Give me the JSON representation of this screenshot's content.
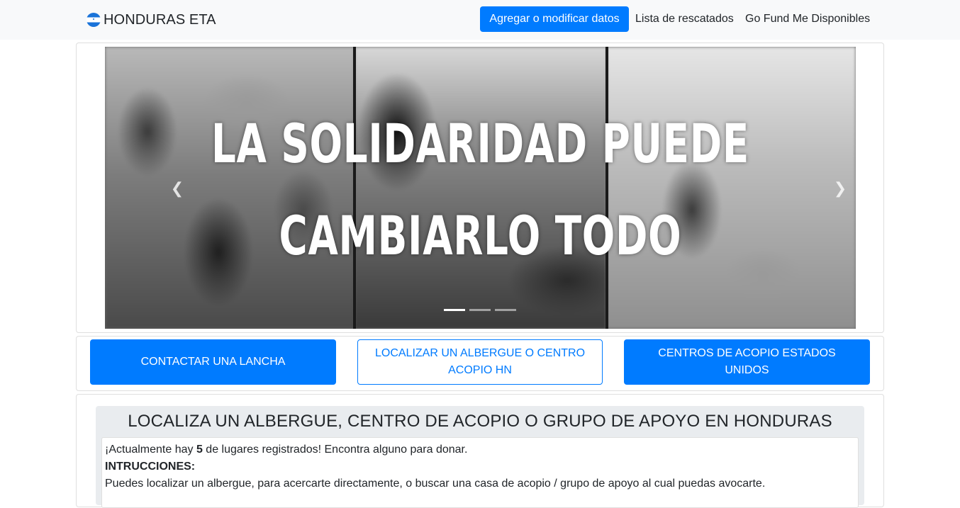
{
  "navbar": {
    "brand": "HONDURAS ETA",
    "primary_button": "Agregar o modificar datos",
    "links": [
      "Lista de rescatados",
      "Go Fund Me Disponibles"
    ]
  },
  "carousel": {
    "caption_line1": "LA SOLIDARIDAD PUEDE",
    "caption_line2": "CAMBIARLO TODO",
    "prev_label": "Previous",
    "next_label": "Next",
    "slide_count": 3,
    "active_slide": 1
  },
  "actions": {
    "contact_boat": "CONTACTAR UNA LANCHA",
    "locate_shelter": "LOCALIZAR UN ALBERGUE O CENTRO ACOPIO HN",
    "us_centers": "CENTROS DE ACOPIO ESTADOS UNIDOS"
  },
  "info": {
    "title": "LOCALIZA UN ALBERGUE, CENTRO DE ACOPIO O GRUPO DE APOYO EN HONDURAS",
    "count_prefix": "¡Actualmente hay ",
    "count": "5",
    "count_suffix": " de lugares registrados! Encontra alguno para donar.",
    "instructions_label": "INTRUCCIONES:",
    "instructions_text": "Puedes localizar un albergue, para acercarte directamente, o buscar una casa de acopio / grupo de apoyo al cual puedas avocarte."
  },
  "colors": {
    "primary": "#007bff",
    "navbar_bg": "#f8f9fa",
    "jumbotron_bg": "#e9ecef"
  }
}
